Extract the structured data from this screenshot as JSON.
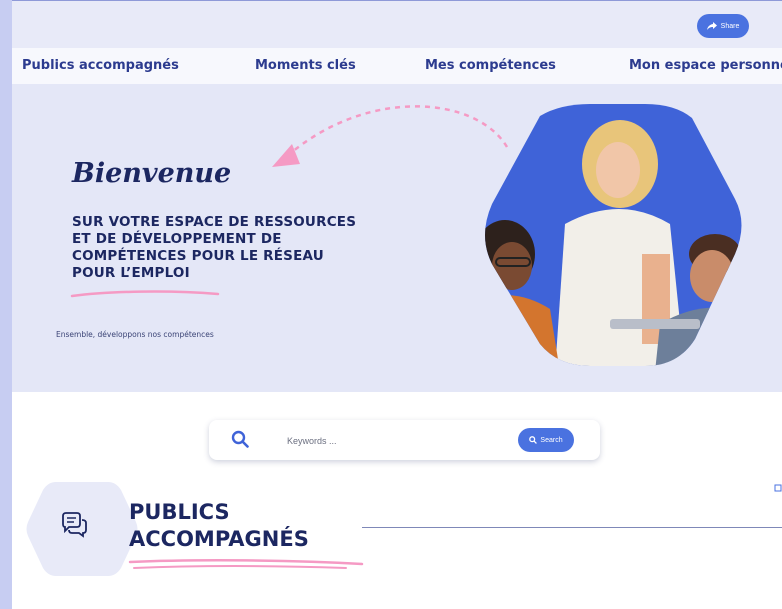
{
  "colors": {
    "accent": "#4a72e0",
    "navy": "#1c2761",
    "nav_text": "#2c3b8f",
    "pink": "#f59ac4",
    "hero_bg": "#e4e7f7"
  },
  "topbar": {
    "share_label": "Share",
    "share_icon": "share-arrow-icon"
  },
  "nav": {
    "items": [
      {
        "label": "Publics accompagnés"
      },
      {
        "label": "Moments clés"
      },
      {
        "label": "Mes compétences"
      },
      {
        "label": "Mon espace personne"
      }
    ]
  },
  "hero": {
    "welcome": "Bienvenue",
    "subtitle_lines": [
      "SUR VOTRE ESPACE DE RESSOURCES",
      "ET DE DÉVELOPPEMENT DE",
      "COMPÉTENCES POUR LE RÉSEAU",
      "POUR L’EMPLOI"
    ],
    "tagline": "Ensemble, développons nos compétences"
  },
  "search": {
    "placeholder": "Keywords ...",
    "button_label": "Search",
    "icon": "search-icon"
  },
  "section": {
    "title_lines": [
      "PUBLICS",
      "ACCOMPAGNÉS"
    ],
    "icon": "chat-bubbles-icon"
  }
}
